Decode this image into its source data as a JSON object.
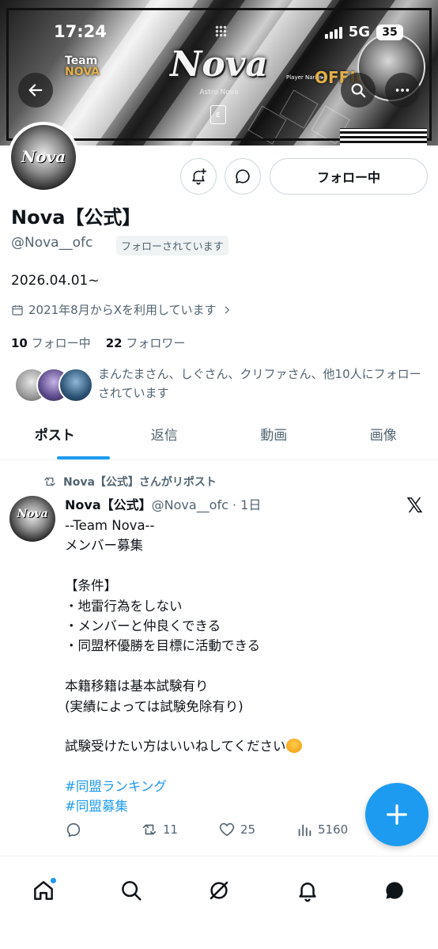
{
  "status_bar": {
    "time": "17:24",
    "network": "5G",
    "battery": "35"
  },
  "banner": {
    "logo": "Nova",
    "subtitle": "Astro Nova",
    "team_line1": "Team",
    "team_line2": "NOVA",
    "official": "OFFICIAL",
    "player_name": "Player Name▸"
  },
  "profile": {
    "display_name": "Nova【公式】",
    "handle": "@Nova__ofc",
    "follows_you": "フォローされています",
    "bio": "2026.04.01~",
    "joined": "2021年8月からXを利用しています",
    "following_count": "10",
    "following_label": "フォロー中",
    "followers_count": "22",
    "followers_label": "フォロワー",
    "mutuals_text": "まんたまさん、しぐさん、クリファさん、他10人にフォローされています",
    "follow_button": "フォロー中",
    "avatar_text": "Nova"
  },
  "tabs": [
    "ポスト",
    "返信",
    "動画",
    "画像"
  ],
  "post": {
    "repost_label": "Nova【公式】さんがリポスト",
    "author": "Nova【公式】",
    "handle_time": "@Nova__ofc · 1日",
    "lines": [
      "--Team Nova--",
      "メンバー募集",
      "",
      "【条件】",
      "・地雷行為をしない",
      "・メンバーと仲良くできる",
      "・同盟杯優勝を目標に活動できる",
      "",
      "本籍移籍は基本試験有り",
      "(実績によっては試験免除有り)",
      "",
      "試験受けたい方はいいねしてください"
    ],
    "hashtags": [
      "#同盟ランキング",
      "#同盟募集"
    ],
    "retweets": "11",
    "likes": "25",
    "views": "5160"
  },
  "colors": {
    "accent": "#1d9bf0",
    "text": "#0f1419",
    "muted": "#536471"
  },
  "icons": {
    "back": "arrow-left-icon",
    "search": "search-icon",
    "more": "more-icon",
    "notify": "bell-plus-icon",
    "message": "message-icon",
    "calendar": "calendar-icon",
    "repost": "repost-icon",
    "reply": "reply-icon",
    "like": "heart-icon",
    "views": "views-icon",
    "compose": "plus-icon",
    "nav": [
      "home-icon",
      "search-icon",
      "grok-icon",
      "bell-icon",
      "messages-icon"
    ]
  }
}
